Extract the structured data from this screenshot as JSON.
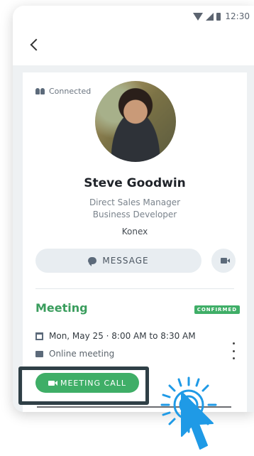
{
  "status_bar": {
    "time": "12:30"
  },
  "profile": {
    "connection_status": "Connected",
    "name": "Steve Goodwin",
    "role_line_1": "Direct Sales Manager",
    "role_line_2": "Business Developer",
    "company": "Konex"
  },
  "actions": {
    "message_label": "MESSAGE",
    "video_icon": "video-camera-icon"
  },
  "meeting": {
    "title": "Meeting",
    "status_badge": "CONFIRMED",
    "date_time": "Mon, May 25 · 8:00 AM to 8:30 AM",
    "location": "Online meeting",
    "call_button_label": "MEETING CALL"
  },
  "colors": {
    "accent_green": "#3fae67",
    "meeting_title": "#3a9d5d",
    "highlight_border": "#2f3f46",
    "cursor_blue": "#1f9ae6"
  }
}
